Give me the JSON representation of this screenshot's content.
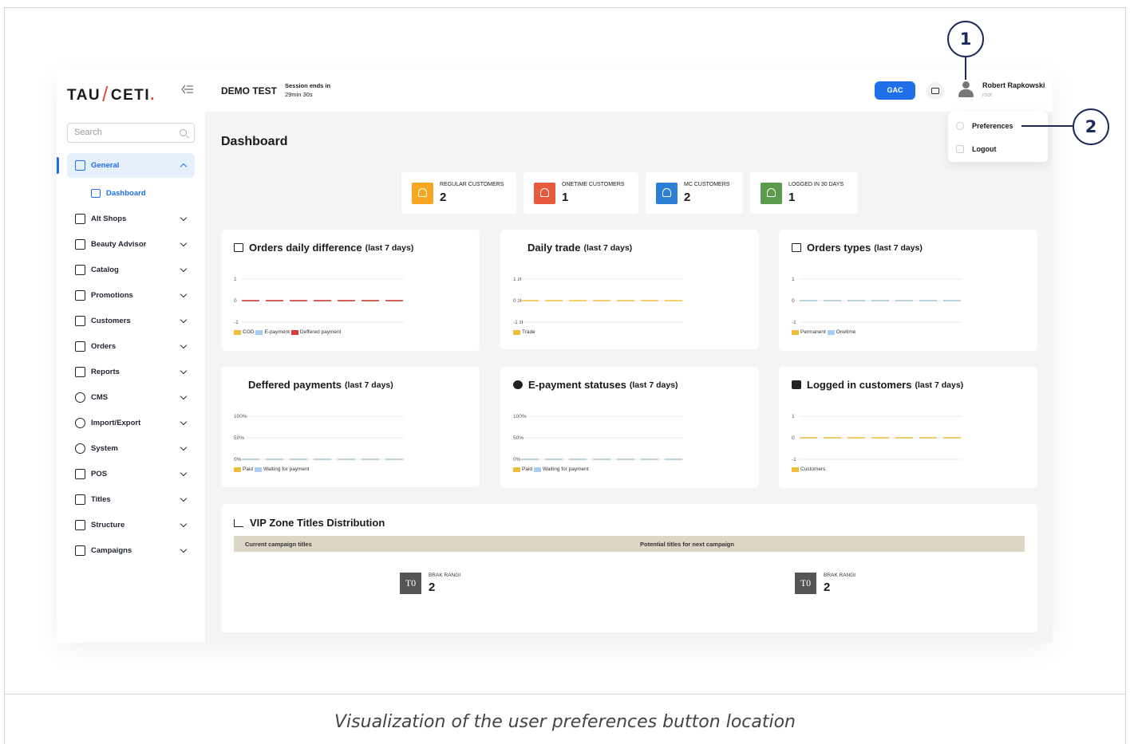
{
  "caption": "Visualization of the user preferences button location",
  "callouts": [
    "1",
    "2"
  ],
  "brand": {
    "part1": "TAU",
    "slash": "/",
    "part2": "CETI",
    "dot": "."
  },
  "sidebar": {
    "search_placeholder": "Search",
    "items": [
      {
        "label": "General",
        "icon": "home-icon",
        "active": true
      },
      {
        "label": "Alt Shops",
        "icon": "branch-icon"
      },
      {
        "label": "Beauty Advisor",
        "icon": "advisor-icon"
      },
      {
        "label": "Catalog",
        "icon": "folder-icon"
      },
      {
        "label": "Promotions",
        "icon": "gift-icon"
      },
      {
        "label": "Customers",
        "icon": "users-icon"
      },
      {
        "label": "Orders",
        "icon": "cart-icon"
      },
      {
        "label": "Reports",
        "icon": "trend-icon"
      },
      {
        "label": "CMS",
        "icon": "globe-icon"
      },
      {
        "label": "Import/Export",
        "icon": "share-icon"
      },
      {
        "label": "System",
        "icon": "gear-icon"
      },
      {
        "label": "POS",
        "icon": "cart-icon"
      },
      {
        "label": "Titles",
        "icon": "clipboard-icon"
      },
      {
        "label": "Structure",
        "icon": "command-icon"
      },
      {
        "label": "Campaigns",
        "icon": "briefcase-icon"
      }
    ],
    "sub_item": "Dashboard"
  },
  "topbar": {
    "shop_name": "DEMO TEST",
    "session_label": "Session ends in",
    "session_time": "29min 30s",
    "gac_label": "GAC",
    "user_name": "Robert Rapkowski",
    "user_role": "root"
  },
  "user_menu": {
    "preferences": "Preferences",
    "logout": "Logout"
  },
  "page_title": "Dashboard",
  "stats": [
    {
      "label": "REGULAR CUSTOMERS",
      "value": "2",
      "color": "#f5a623"
    },
    {
      "label": "ONETIME CUSTOMERS",
      "value": "1",
      "color": "#e85a3c"
    },
    {
      "label": "MC CUSTOMERS",
      "value": "2",
      "color": "#2d7fd3"
    },
    {
      "label": "LOGGED IN 30 DAYS",
      "value": "1",
      "color": "#5c9a4c"
    }
  ],
  "colors": {
    "accent": "#1e6fe8",
    "yellow": "#f0bd3a",
    "light_blue": "#a9cdf0",
    "red": "#d83a3a",
    "table_header": "#ded6c4"
  },
  "cards": [
    {
      "title": "Orders daily difference",
      "subtitle": "(last 7 days)",
      "icon": "cart-icon"
    },
    {
      "title": "Daily trade",
      "subtitle": "(last 7 days)",
      "icon": "none"
    },
    {
      "title": "Orders types",
      "subtitle": "(last 7 days)",
      "icon": "list-icon"
    },
    {
      "title": "Deffered payments",
      "subtitle": "(last 7 days)",
      "icon": "none"
    },
    {
      "title": "E-payment statuses",
      "subtitle": "(last 7 days)",
      "icon": "alert-icon"
    },
    {
      "title": "Logged in customers",
      "subtitle": "(last 7 days)",
      "icon": "lock-icon"
    }
  ],
  "chart_data": [
    {
      "type": "line",
      "title": "Orders daily difference (last 7 days)",
      "y_ticks": [
        "1",
        "0",
        "-1"
      ],
      "ylim": [
        -1,
        1
      ],
      "series": [
        {
          "name": "COD",
          "values": [
            0,
            0,
            0,
            0,
            0,
            0,
            0
          ],
          "color": "#f0bd3a"
        },
        {
          "name": "E-payment",
          "values": [
            0,
            0,
            0,
            0,
            0,
            0,
            0
          ],
          "color": "#a9cdf0"
        },
        {
          "name": "Deffered payment",
          "values": [
            0,
            0,
            0,
            0,
            0,
            0,
            0
          ],
          "color": "#d83a3a"
        }
      ]
    },
    {
      "type": "line",
      "title": "Daily trade (last 7 days)",
      "y_ticks": [
        "1 zł",
        "0 zł",
        "-1 zł"
      ],
      "ylim": [
        -1,
        1
      ],
      "series": [
        {
          "name": "Trade",
          "values": [
            0,
            0,
            0,
            0,
            0,
            0,
            0
          ],
          "color": "#f0bd3a"
        }
      ]
    },
    {
      "type": "line",
      "title": "Orders types (last 7 days)",
      "y_ticks": [
        "1",
        "0",
        "-1"
      ],
      "ylim": [
        -1,
        1
      ],
      "series": [
        {
          "name": "Permanent",
          "values": [
            0,
            0,
            0,
            0,
            0,
            0,
            0
          ],
          "color": "#f0bd3a"
        },
        {
          "name": "Onetime",
          "values": [
            0,
            0,
            0,
            0,
            0,
            0,
            0
          ],
          "color": "#a9cdf0"
        }
      ]
    },
    {
      "type": "line",
      "title": "Deffered payments (last 7 days)",
      "y_ticks": [
        "100%",
        "50%",
        "0%"
      ],
      "ylim": [
        0,
        100
      ],
      "series": [
        {
          "name": "Paid",
          "values": [
            0,
            0,
            0,
            0,
            0,
            0,
            0
          ],
          "color": "#f0bd3a"
        },
        {
          "name": "Waiting for payment",
          "values": [
            0,
            0,
            0,
            0,
            0,
            0,
            0
          ],
          "color": "#a9cdf0"
        }
      ]
    },
    {
      "type": "line",
      "title": "E-payment statuses (last 7 days)",
      "y_ticks": [
        "100%",
        "50%",
        "0%"
      ],
      "ylim": [
        0,
        100
      ],
      "series": [
        {
          "name": "Paid",
          "values": [
            0,
            0,
            0,
            0,
            0,
            0,
            0
          ],
          "color": "#f0bd3a"
        },
        {
          "name": "Waiting for payment",
          "values": [
            0,
            0,
            0,
            0,
            0,
            0,
            0
          ],
          "color": "#a9cdf0"
        }
      ]
    },
    {
      "type": "line",
      "title": "Logged in customers (last 7 days)",
      "y_ticks": [
        "1",
        "0",
        "-1"
      ],
      "ylim": [
        -1,
        1
      ],
      "series": [
        {
          "name": "Customers",
          "values": [
            0,
            0,
            0,
            0,
            0,
            0,
            0
          ],
          "color": "#f0bd3a"
        }
      ]
    }
  ],
  "vip": {
    "title": "VIP Zone Titles Distribution",
    "col_current": "Current campaign titles",
    "col_potential": "Potential titles for next campaign",
    "current": {
      "badge": "T0",
      "label": "BRAK RANGI",
      "value": "2"
    },
    "potential": {
      "badge": "T0",
      "label": "BRAK RANGI",
      "value": "2"
    }
  }
}
